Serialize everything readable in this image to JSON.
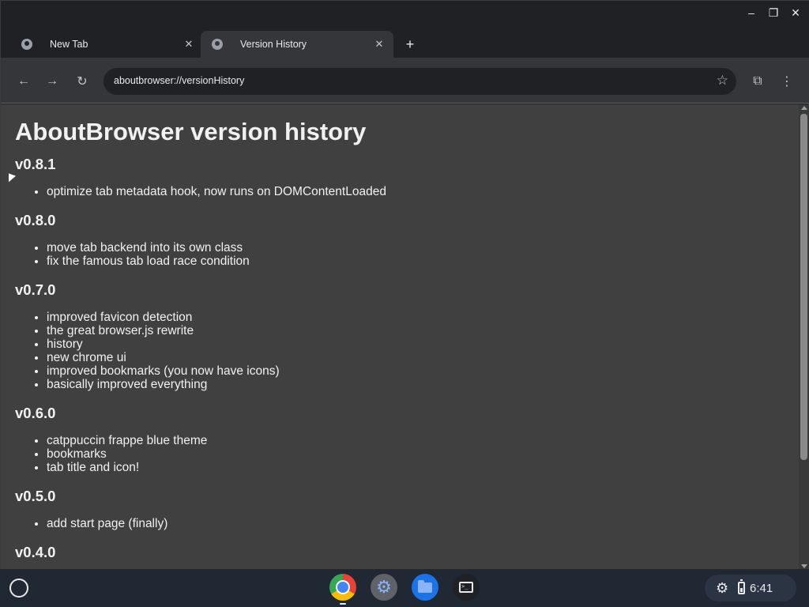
{
  "window": {
    "minimize_glyph": "–",
    "maximize_glyph": "❐",
    "close_glyph": "✕"
  },
  "tabs": [
    {
      "label": "New Tab",
      "icon": "globe-icon",
      "active": false
    },
    {
      "label": "Version History",
      "icon": "globe-icon",
      "active": true
    }
  ],
  "tab_close_glyph": "✕",
  "new_tab_glyph": "+",
  "toolbar": {
    "back_glyph": "←",
    "forward_glyph": "→",
    "reload_glyph": "↻",
    "url": "aboutbrowser://versionHistory",
    "bookmark_glyph": "☆",
    "extensions_glyph": "⧉",
    "menu_glyph": "⋮"
  },
  "page": {
    "title": "AboutBrowser version history",
    "versions": [
      {
        "version": "v0.8.1",
        "notes": [
          "optimize tab metadata hook, now runs on DOMContentLoaded"
        ]
      },
      {
        "version": "v0.8.0",
        "notes": [
          "move tab backend into its own class",
          "fix the famous tab load race condition"
        ]
      },
      {
        "version": "v0.7.0",
        "notes": [
          "improved favicon detection",
          "the great browser.js rewrite",
          "history",
          "new chrome ui",
          "improved bookmarks (you now have icons)",
          "basically improved everything"
        ]
      },
      {
        "version": "v0.6.0",
        "notes": [
          "catppuccin frappe blue theme",
          "bookmarks",
          "tab title and icon!"
        ]
      },
      {
        "version": "v0.5.0",
        "notes": [
          "add start page (finally)"
        ]
      },
      {
        "version": "v0.4.0",
        "notes": []
      }
    ]
  },
  "shelf": {
    "apps": [
      "chrome-icon",
      "settings-icon",
      "files-icon",
      "terminal-icon"
    ],
    "settings_glyph": "⚙",
    "tray_gear_glyph": "⚙",
    "time": "6:41"
  },
  "colors": {
    "page_background": "#404040",
    "toolbar": "#35363a",
    "tabstrip": "#202124",
    "shelf": "#1f2833"
  }
}
